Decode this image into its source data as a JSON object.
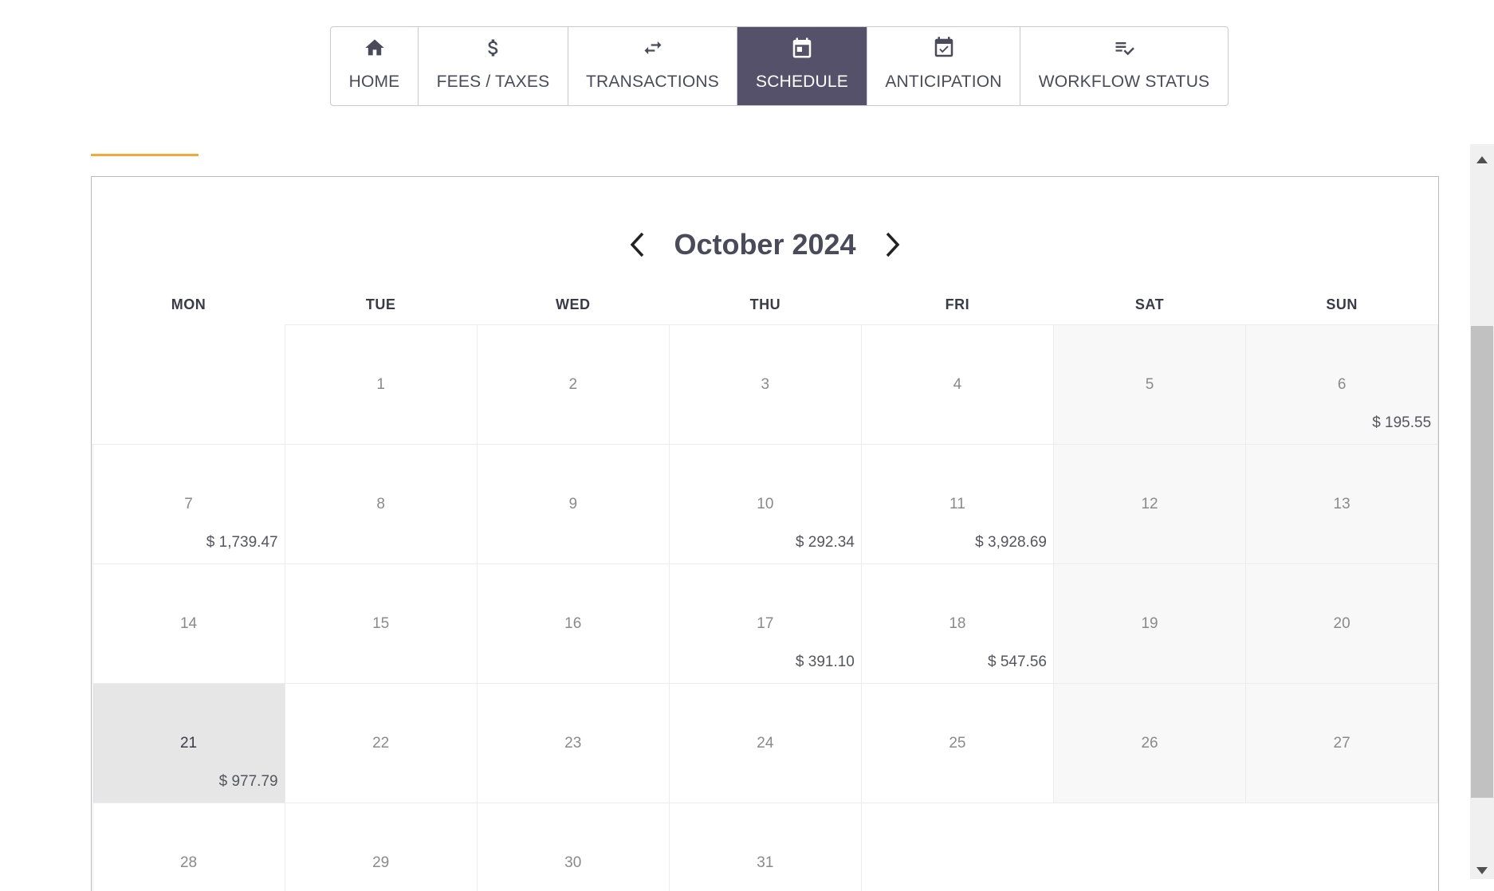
{
  "tabs": [
    {
      "label": "HOME",
      "icon": "home-icon"
    },
    {
      "label": "FEES / TAXES",
      "icon": "dollar-icon"
    },
    {
      "label": "TRANSACTIONS",
      "icon": "swap-arrows-icon"
    },
    {
      "label": "SCHEDULE",
      "icon": "calendar-icon",
      "active": true
    },
    {
      "label": "ANTICIPATION",
      "icon": "calendar-check-icon"
    },
    {
      "label": "WORKFLOW STATUS",
      "icon": "checklist-icon"
    }
  ],
  "colors": {
    "active_tab_bg": "#55516a",
    "accent": "#f2a93b",
    "weekend_bg": "#f8f8f8",
    "selected_day_bg": "#e6e6e6"
  },
  "calendar": {
    "month_title": "October 2024",
    "prev_icon": "chevron-left-icon",
    "next_icon": "chevron-right-icon",
    "weekdays": [
      "MON",
      "TUE",
      "WED",
      "THU",
      "FRI",
      "SAT",
      "SUN"
    ],
    "leading_blank_days": 1,
    "selected_day": "21",
    "weekend_columns": [
      5,
      6
    ],
    "days": [
      {
        "day": "1"
      },
      {
        "day": "2"
      },
      {
        "day": "3"
      },
      {
        "day": "4"
      },
      {
        "day": "5"
      },
      {
        "day": "6",
        "amount": "$ 195.55"
      },
      {
        "day": "7",
        "amount": "$ 1,739.47"
      },
      {
        "day": "8"
      },
      {
        "day": "9"
      },
      {
        "day": "10",
        "amount": "$ 292.34"
      },
      {
        "day": "11",
        "amount": "$ 3,928.69"
      },
      {
        "day": "12"
      },
      {
        "day": "13"
      },
      {
        "day": "14"
      },
      {
        "day": "15"
      },
      {
        "day": "16"
      },
      {
        "day": "17",
        "amount": "$ 391.10"
      },
      {
        "day": "18",
        "amount": "$ 547.56"
      },
      {
        "day": "19"
      },
      {
        "day": "20"
      },
      {
        "day": "21",
        "amount": "$ 977.79"
      },
      {
        "day": "22"
      },
      {
        "day": "23"
      },
      {
        "day": "24"
      },
      {
        "day": "25"
      },
      {
        "day": "26"
      },
      {
        "day": "27"
      },
      {
        "day": "28"
      },
      {
        "day": "29"
      },
      {
        "day": "30"
      },
      {
        "day": "31"
      }
    ]
  },
  "scrollbar": {
    "up_icon": "scroll-up-arrow-icon",
    "down_icon": "scroll-down-arrow-icon"
  }
}
